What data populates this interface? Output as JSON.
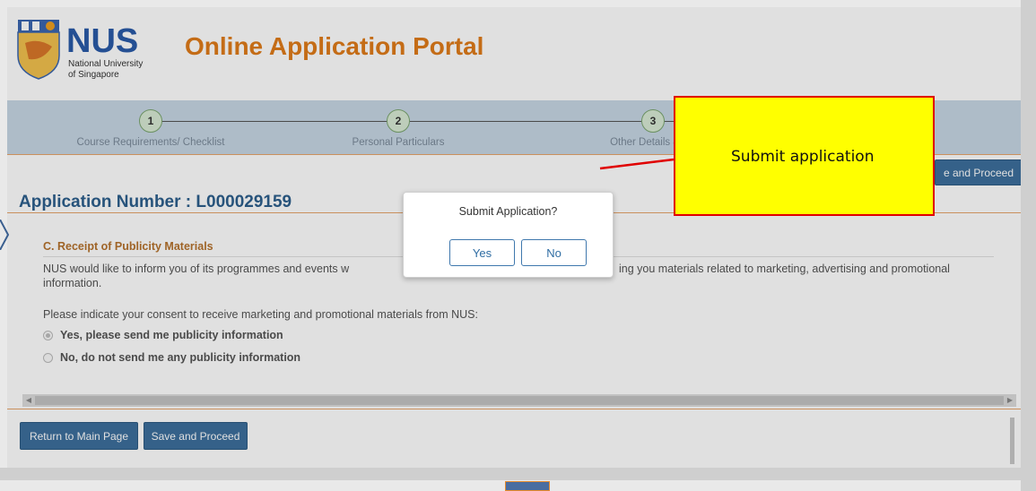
{
  "header": {
    "logo_name": "NUS",
    "logo_subtitle_line1": "National University",
    "logo_subtitle_line2": "of Singapore",
    "portal_title": "Online Application Portal"
  },
  "steps": [
    {
      "number": "1",
      "label": "Course Requirements/ Checklist"
    },
    {
      "number": "2",
      "label": "Personal Particulars"
    },
    {
      "number": "3",
      "label": "Other Details & De"
    }
  ],
  "toolbar": {
    "save_proceed_partial": "e and Proceed"
  },
  "application": {
    "number_label": "Application Number : L000029159"
  },
  "section": {
    "title": "C. Receipt of Publicity Materials",
    "intro_left": "NUS would like to inform you of its programmes and events w",
    "intro_right": "ing you materials related to marketing, advertising and promotional",
    "intro_line2": "information.",
    "consent_prompt": "Please indicate your consent to receive marketing and promotional materials from NUS:",
    "options": [
      {
        "label": "Yes, please send me publicity information",
        "checked": true
      },
      {
        "label": "No, do not send me any publicity information",
        "checked": false
      }
    ]
  },
  "footer": {
    "return_label": "Return to Main Page",
    "save_label": "Save and Proceed"
  },
  "dialog": {
    "title": "Submit Application?",
    "yes_label": "Yes",
    "no_label": "No"
  },
  "callout": {
    "text": "Submit application"
  },
  "colors": {
    "brand_orange": "#e07b1a",
    "brand_blue": "#2d5f8c",
    "button_blue": "#3d6f9c",
    "callout_fill": "#ffff00",
    "callout_border": "#e00000"
  }
}
